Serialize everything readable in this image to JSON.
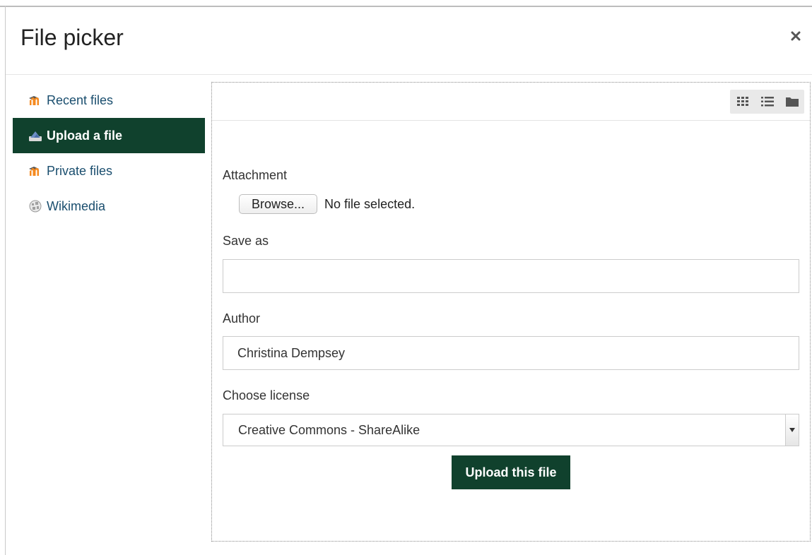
{
  "dialog": {
    "title": "File picker",
    "close_icon": "close-icon"
  },
  "sidebar": {
    "items": [
      {
        "label": "Recent files",
        "icon": "moodle-icon",
        "active": false
      },
      {
        "label": "Upload a file",
        "icon": "upload-icon",
        "active": true
      },
      {
        "label": "Private files",
        "icon": "moodle-icon",
        "active": false
      },
      {
        "label": "Wikimedia",
        "icon": "wikipedia-globe-icon",
        "active": false
      }
    ]
  },
  "toolbar": {
    "view_buttons": [
      "grid-view-icon",
      "list-view-icon",
      "folder-view-icon"
    ]
  },
  "form": {
    "attachment_label": "Attachment",
    "browse_label": "Browse...",
    "file_status": "No file selected.",
    "save_as_label": "Save as",
    "save_as_value": "",
    "author_label": "Author",
    "author_value": "Christina Dempsey",
    "license_label": "Choose license",
    "license_value": "Creative Commons - ShareAlike",
    "upload_label": "Upload this file"
  },
  "colors": {
    "accent": "#10412d",
    "link": "#1a4e6e",
    "moodle_orange": "#f58a1f"
  }
}
